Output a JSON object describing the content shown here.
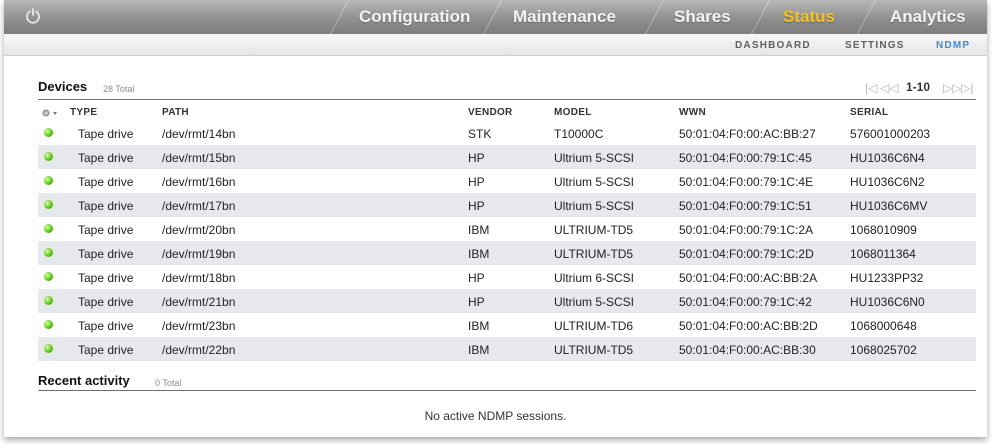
{
  "top_nav": {
    "tabs": [
      {
        "label": "Configuration"
      },
      {
        "label": "Maintenance"
      },
      {
        "label": "Shares"
      },
      {
        "label": "Status"
      },
      {
        "label": "Analytics"
      }
    ],
    "active": "Status"
  },
  "sub_nav": {
    "tabs": [
      {
        "label": "DASHBOARD"
      },
      {
        "label": "SETTINGS"
      },
      {
        "label": "NDMP"
      }
    ],
    "active": "NDMP"
  },
  "devices": {
    "title": "Devices",
    "count": "28 Total",
    "pager": {
      "first": "|◁",
      "prev": "◁◁",
      "range": "1-10",
      "next": "▷▷",
      "last": "▷|"
    },
    "columns": {
      "status": "",
      "type": "TYPE",
      "path": "PATH",
      "vendor": "VENDOR",
      "model": "MODEL",
      "wwn": "WWN",
      "serial": "SERIAL"
    },
    "rows": [
      {
        "type": "Tape drive",
        "path": "/dev/rmt/14bn",
        "vendor": "STK",
        "model": "T10000C",
        "wwn": "50:01:04:F0:00:AC:BB:27",
        "serial": "576001000203"
      },
      {
        "type": "Tape drive",
        "path": "/dev/rmt/15bn",
        "vendor": "HP",
        "model": "Ultrium 5-SCSI",
        "wwn": "50:01:04:F0:00:79:1C:45",
        "serial": "HU1036C6N4"
      },
      {
        "type": "Tape drive",
        "path": "/dev/rmt/16bn",
        "vendor": "HP",
        "model": "Ultrium 5-SCSI",
        "wwn": "50:01:04:F0:00:79:1C:4E",
        "serial": "HU1036C6N2"
      },
      {
        "type": "Tape drive",
        "path": "/dev/rmt/17bn",
        "vendor": "HP",
        "model": "Ultrium 5-SCSI",
        "wwn": "50:01:04:F0:00:79:1C:51",
        "serial": "HU1036C6MV"
      },
      {
        "type": "Tape drive",
        "path": "/dev/rmt/20bn",
        "vendor": "IBM",
        "model": "ULTRIUM-TD5",
        "wwn": "50:01:04:F0:00:79:1C:2A",
        "serial": "1068010909"
      },
      {
        "type": "Tape drive",
        "path": "/dev/rmt/19bn",
        "vendor": "IBM",
        "model": "ULTRIUM-TD5",
        "wwn": "50:01:04:F0:00:79:1C:2D",
        "serial": "1068011364"
      },
      {
        "type": "Tape drive",
        "path": "/dev/rmt/18bn",
        "vendor": "HP",
        "model": "Ultrium 6-SCSI",
        "wwn": "50:01:04:F0:00:AC:BB:2A",
        "serial": "HU1233PP32"
      },
      {
        "type": "Tape drive",
        "path": "/dev/rmt/21bn",
        "vendor": "HP",
        "model": "Ultrium 5-SCSI",
        "wwn": "50:01:04:F0:00:79:1C:42",
        "serial": "HU1036C6N0"
      },
      {
        "type": "Tape drive",
        "path": "/dev/rmt/23bn",
        "vendor": "IBM",
        "model": "ULTRIUM-TD6",
        "wwn": "50:01:04:F0:00:AC:BB:2D",
        "serial": "1068000648"
      },
      {
        "type": "Tape drive",
        "path": "/dev/rmt/22bn",
        "vendor": "IBM",
        "model": "ULTRIUM-TD5",
        "wwn": "50:01:04:F0:00:AC:BB:30",
        "serial": "1068025702"
      }
    ]
  },
  "recent_activity": {
    "title": "Recent activity",
    "count": "0 Total",
    "empty_message": "No active NDMP sessions."
  },
  "colors": {
    "active_tab": "#f5c21c",
    "active_subtab": "#3f8ad6",
    "status_online": "#57c21a"
  }
}
